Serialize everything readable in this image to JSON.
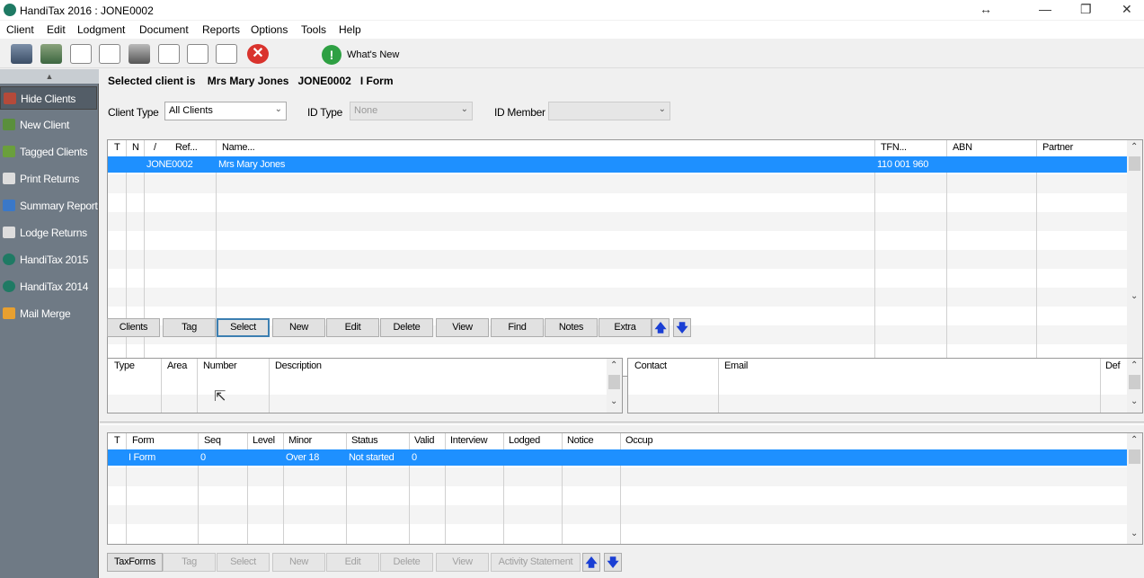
{
  "window": {
    "title": "HandiTax 2016 : JONE0002",
    "controls": {
      "resize": "↔",
      "minimize": "—",
      "restore": "❐",
      "close": "✕"
    }
  },
  "menu": [
    "Client",
    "Edit",
    "Lodgment",
    "Document",
    "Reports",
    "Options",
    "Tools",
    "Help"
  ],
  "toolbar": {
    "whats_new": "What's New",
    "close_glyph": "✕",
    "info_glyph": "!"
  },
  "sidebar": {
    "scroll_up": "▲",
    "items": [
      {
        "label": "Hide Clients",
        "color": "#b54a3a"
      },
      {
        "label": "New Client",
        "color": "#5a8f3c"
      },
      {
        "label": "Tagged Clients",
        "color": "#6a9f3c"
      },
      {
        "label": "Print Returns",
        "color": "#dddddd"
      },
      {
        "label": "Summary Report",
        "color": "#3a78c8"
      },
      {
        "label": "Lodge Returns",
        "color": "#dddddd"
      },
      {
        "label": "HandiTax 2015",
        "color": "#1f7a64"
      },
      {
        "label": "HandiTax 2014",
        "color": "#1f7a64"
      },
      {
        "label": "Mail Merge",
        "color": "#e8a030"
      }
    ]
  },
  "main": {
    "selected_prefix": "Selected client is",
    "selected_name": "Mrs Mary Jones",
    "selected_ref": "JONE0002",
    "selected_form": "I Form",
    "filters": {
      "client_type_label": "Client Type",
      "client_type_value": "All Clients",
      "id_type_label": "ID Type",
      "id_type_value": "None",
      "id_member_label": "ID Member",
      "id_member_value": ""
    },
    "client_grid": {
      "headers": [
        "T",
        "N",
        "/",
        "Ref...",
        "Name...",
        "TFN...",
        "ABN",
        "Partner"
      ],
      "selected_row": {
        "ref": "JONE0002",
        "name": "Mrs Mary Jones",
        "tfn": "110 001 960",
        "abn": "",
        "partner": ""
      }
    },
    "client_buttons": [
      "Clients",
      "Tag",
      "Select",
      "New",
      "Edit",
      "Delete",
      "View",
      "Find",
      "Notes",
      "Extra"
    ],
    "phone_grid": {
      "headers": [
        "Type",
        "Area",
        "Number",
        "Description"
      ]
    },
    "contact_grid": {
      "headers": [
        "Contact",
        "Email",
        "Def"
      ]
    },
    "form_grid": {
      "headers": [
        "T",
        "Form",
        "Seq",
        "Level",
        "Minor",
        "Status",
        "Valid",
        "Interview",
        "Lodged",
        "Notice",
        "Occup"
      ],
      "selected_row": {
        "form": "I Form",
        "seq": "0",
        "level": "",
        "minor": "Over 18",
        "status": "Not started",
        "valid": "0"
      }
    },
    "form_buttons": [
      "TaxForms",
      "Tag",
      "Select",
      "New",
      "Edit",
      "Delete",
      "View",
      "Activity Statement"
    ],
    "arrows": {
      "up": "🡅",
      "down": "🡇"
    },
    "scroll": {
      "up": "⌃",
      "down": "⌄"
    }
  },
  "colors": {
    "selection": "#1e90ff",
    "sidebar_bg": "#6f7a85",
    "arrow_blue": "#1a3fd4"
  }
}
